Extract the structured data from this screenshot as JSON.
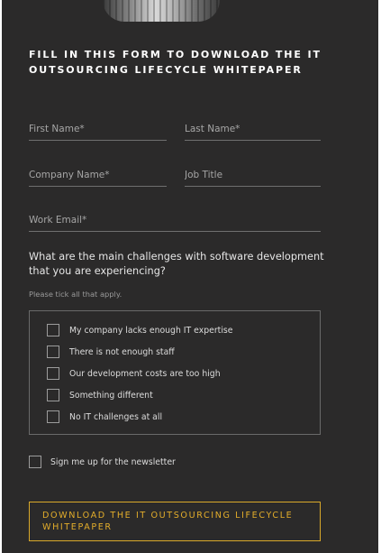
{
  "form": {
    "title": "FILL IN THIS FORM TO DOWNLOAD THE IT OUTSOURCING LIFECYCLE WHITEPAPER",
    "fields": {
      "first_name": {
        "placeholder": "First Name*",
        "value": ""
      },
      "last_name": {
        "placeholder": "Last Name*",
        "value": ""
      },
      "company_name": {
        "placeholder": "Company Name*",
        "value": ""
      },
      "job_title": {
        "placeholder": "Job Title",
        "value": ""
      },
      "work_email": {
        "placeholder": "Work Email*",
        "value": ""
      }
    },
    "question": "What are the main challenges with software development that you are experiencing?",
    "hint": "Please tick all that apply.",
    "options": [
      {
        "label": "My company lacks enough IT expertise",
        "checked": false
      },
      {
        "label": "There is not enough staff",
        "checked": false
      },
      {
        "label": "Our development costs are too high",
        "checked": false
      },
      {
        "label": "Something different",
        "checked": false
      },
      {
        "label": "No IT challenges at all",
        "checked": false
      }
    ],
    "newsletter": {
      "label": "Sign me up for the newsletter",
      "checked": false
    },
    "submit_label": "DOWNLOAD THE IT OUTSOURCING LIFECYCLE WHITEPAPER"
  },
  "colors": {
    "panel_background": "#2b2a2a",
    "accent": "#e3ad2a",
    "border": "#6f6f6f",
    "text": "#ffffff"
  }
}
